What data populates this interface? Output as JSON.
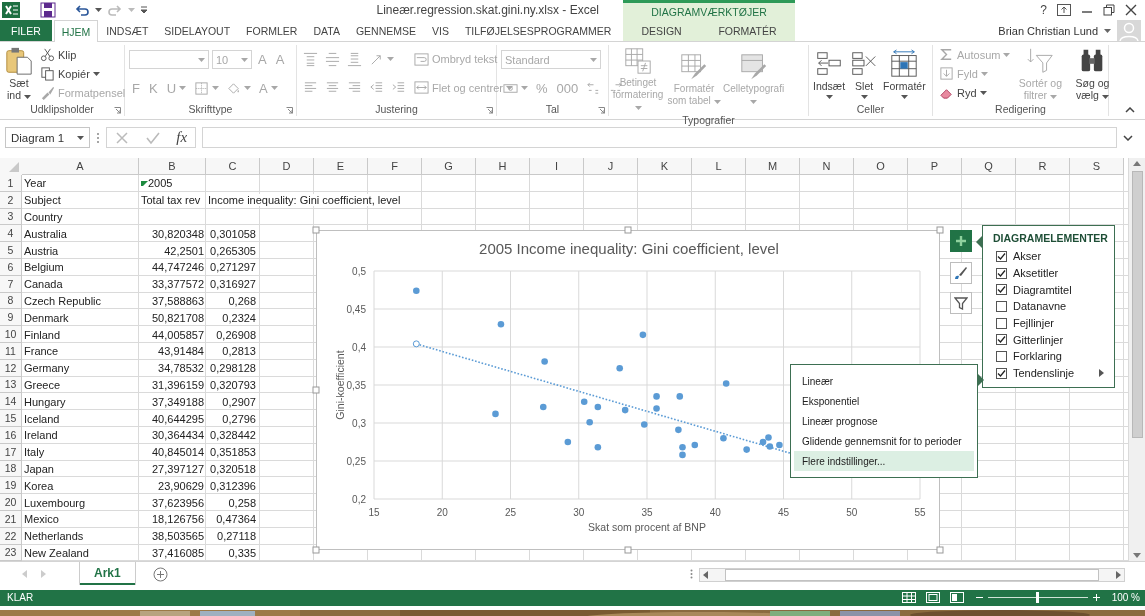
{
  "title_bar": {
    "title": "Lineær.regression.skat.gini.ny.xlsx - Excel",
    "context_label": "DIAGRAMVÆRKTØJER",
    "help": "?",
    "user": "Brian Christian Lund"
  },
  "tabs": [
    {
      "label": "FILER",
      "kind": "file",
      "selected": false
    },
    {
      "label": "HJEM",
      "kind": "tab",
      "selected": true
    },
    {
      "label": "INDSÆT",
      "kind": "tab",
      "selected": false
    },
    {
      "label": "SIDELAYOUT",
      "kind": "tab",
      "selected": false
    },
    {
      "label": "FORMLER",
      "kind": "tab",
      "selected": false
    },
    {
      "label": "DATA",
      "kind": "tab",
      "selected": false
    },
    {
      "label": "GENNEMSE",
      "kind": "tab",
      "selected": false
    },
    {
      "label": "VIS",
      "kind": "tab",
      "selected": false
    },
    {
      "label": "TILFØJELSESPROGRAMMER",
      "kind": "tab",
      "selected": false
    },
    {
      "label": "DESIGN",
      "kind": "context",
      "selected": false
    },
    {
      "label": "FORMATÉR",
      "kind": "context",
      "selected": false
    }
  ],
  "ribbon": {
    "groups": [
      {
        "label": "Udklipsholder",
        "launcher": true,
        "columns": [
          [
            [
              {
                "kind": "large",
                "label": "Sæt ind",
                "caret": true,
                "disabled": false
              }
            ]
          ],
          [
            [
              {
                "kind": "small",
                "label": "Klip",
                "caret": false,
                "disabled": false
              }
            ],
            [
              {
                "kind": "small",
                "label": "Kopiér",
                "caret": true,
                "disabled": false
              }
            ],
            [
              {
                "kind": "small",
                "label": "Formatpensel",
                "caret": false,
                "disabled": true
              }
            ]
          ]
        ]
      },
      {
        "label": "Skrifttype",
        "launcher": true,
        "columns": [
          [
            [
              {
                "kind": "name-field",
                "caret": true,
                "disabled": true
              },
              {
                "kind": "size-field",
                "value": "10",
                "caret": true,
                "disabled": true
              },
              {
                "kind": "glyph",
                "label": "A",
                "caret": false,
                "disabled": true
              },
              {
                "kind": "glyph",
                "label": "A",
                "caret": false,
                "disabled": true
              }
            ],
            [
              {
                "kind": "glyph",
                "label": "F",
                "caret": false,
                "disabled": true
              },
              {
                "kind": "glyph",
                "label": "K",
                "caret": false,
                "disabled": true
              },
              {
                "kind": "glyph",
                "label": "U",
                "caret": true,
                "disabled": true
              },
              {
                "kind": "icon",
                "caret": true,
                "disabled": true
              },
              {
                "kind": "icon",
                "caret": true,
                "disabled": true
              },
              {
                "kind": "glyph",
                "label": "A",
                "caret": true,
                "disabled": true
              }
            ]
          ]
        ]
      },
      {
        "label": "Justering",
        "launcher": true,
        "columns": [
          [
            [
              {
                "kind": "icon",
                "caret": false,
                "disabled": true
              },
              {
                "kind": "icon",
                "caret": false,
                "disabled": true
              },
              {
                "kind": "icon",
                "caret": false,
                "disabled": true
              },
              {
                "kind": "icon",
                "caret": true,
                "disabled": true
              }
            ],
            [
              {
                "kind": "icon",
                "caret": false,
                "disabled": true
              },
              {
                "kind": "icon",
                "caret": false,
                "disabled": true
              },
              {
                "kind": "icon",
                "caret": false,
                "disabled": true
              },
              {
                "kind": "icon",
                "caret": false,
                "disabled": true
              },
              {
                "kind": "icon",
                "caret": false,
                "disabled": true
              }
            ]
          ],
          [
            [
              {
                "kind": "small",
                "label": "Ombryd tekst",
                "caret": false,
                "disabled": true
              }
            ],
            [
              {
                "kind": "small",
                "label": "Flet og centrer",
                "caret": true,
                "disabled": true
              }
            ]
          ]
        ]
      },
      {
        "label": "Tal",
        "launcher": true,
        "columns": [
          [
            [
              {
                "kind": "name-field",
                "value": "Standard",
                "caret": true,
                "disabled": true
              }
            ],
            [
              {
                "kind": "icon",
                "caret": true,
                "disabled": true
              },
              {
                "kind": "glyph",
                "label": "%",
                "caret": false,
                "disabled": true
              },
              {
                "kind": "glyph",
                "label": "000",
                "caret": false,
                "disabled": true
              },
              {
                "kind": "icon",
                "caret": false,
                "disabled": true
              },
              {
                "kind": "icon",
                "caret": false,
                "disabled": true
              }
            ]
          ]
        ]
      },
      {
        "label": "Typografier",
        "launcher": false,
        "columns": [
          [
            [
              {
                "kind": "large",
                "label": "Betinget formatering",
                "caret": true,
                "disabled": true
              }
            ]
          ],
          [
            [
              {
                "kind": "large",
                "label": "Formatér som tabel",
                "caret": true,
                "disabled": true
              }
            ]
          ],
          [
            [
              {
                "kind": "large",
                "label": "Celletypografi",
                "caret": true,
                "disabled": true
              }
            ]
          ]
        ]
      },
      {
        "label": "Celler",
        "launcher": false,
        "columns": [
          [
            [
              {
                "kind": "large",
                "label": "Indsæt",
                "caret": true,
                "disabled": false
              }
            ]
          ],
          [
            [
              {
                "kind": "large",
                "label": "Slet",
                "caret": true,
                "disabled": false
              }
            ]
          ],
          [
            [
              {
                "kind": "large",
                "label": "Formatér",
                "caret": true,
                "disabled": false
              }
            ]
          ]
        ]
      },
      {
        "label": "Redigering",
        "launcher": false,
        "columns": [
          [
            [
              {
                "kind": "small",
                "label": "Autosum",
                "caret": true,
                "disabled": true
              }
            ],
            [
              {
                "kind": "small",
                "label": "Fyld",
                "caret": true,
                "disabled": true
              }
            ],
            [
              {
                "kind": "small",
                "label": "Ryd",
                "caret": true,
                "disabled": false
              }
            ]
          ],
          [
            [
              {
                "kind": "large",
                "label": "Sortér og filtrer",
                "caret": true,
                "disabled": true
              }
            ]
          ],
          [
            [
              {
                "kind": "large",
                "label": "Søg og vælg",
                "caret": true,
                "disabled": false
              }
            ]
          ]
        ]
      }
    ]
  },
  "formula_bar": {
    "name_box": "Diagram 1",
    "fx": "fx"
  },
  "sheet": {
    "columns": [
      "A",
      "B",
      "C",
      "D",
      "E",
      "F",
      "G",
      "H",
      "I",
      "J",
      "K",
      "L",
      "M",
      "N",
      "O",
      "P",
      "Q",
      "R",
      "S"
    ],
    "rows": [
      {
        "number": "1",
        "kind": "label",
        "error_mark": true,
        "cells": [
          "Year",
          "2005"
        ]
      },
      {
        "number": "2",
        "kind": "label",
        "error_mark": false,
        "cells": [
          "Subject",
          "Total tax rev",
          "Income inequality: Gini coefficient, level"
        ]
      },
      {
        "number": "3",
        "kind": "label",
        "error_mark": false,
        "cells": [
          "Country"
        ]
      },
      {
        "number": "4",
        "kind": "data",
        "error_mark": false,
        "cells": [
          "Australia",
          "30,820348",
          "0,301058"
        ]
      },
      {
        "number": "5",
        "kind": "data",
        "error_mark": false,
        "cells": [
          "Austria",
          "42,2501",
          "0,265305"
        ]
      },
      {
        "number": "6",
        "kind": "data",
        "error_mark": false,
        "cells": [
          "Belgium",
          "44,747246",
          "0,271297"
        ]
      },
      {
        "number": "7",
        "kind": "data",
        "error_mark": false,
        "cells": [
          "Canada",
          "33,377572",
          "0,316927"
        ]
      },
      {
        "number": "8",
        "kind": "data",
        "error_mark": false,
        "cells": [
          "Czech Republic",
          "37,588863",
          "0,268"
        ]
      },
      {
        "number": "9",
        "kind": "data",
        "error_mark": false,
        "cells": [
          "Denmark",
          "50,821708",
          "0,2324"
        ]
      },
      {
        "number": "10",
        "kind": "data",
        "error_mark": false,
        "cells": [
          "Finland",
          "44,005857",
          "0,26908"
        ]
      },
      {
        "number": "11",
        "kind": "data",
        "error_mark": false,
        "cells": [
          "France",
          "43,91484",
          "0,2813"
        ]
      },
      {
        "number": "12",
        "kind": "data",
        "error_mark": false,
        "cells": [
          "Germany",
          "34,78532",
          "0,298128"
        ]
      },
      {
        "number": "13",
        "kind": "data",
        "error_mark": false,
        "cells": [
          "Greece",
          "31,396159",
          "0,320793"
        ]
      },
      {
        "number": "14",
        "kind": "data",
        "error_mark": false,
        "cells": [
          "Hungary",
          "37,349188",
          "0,2907"
        ]
      },
      {
        "number": "15",
        "kind": "data",
        "error_mark": false,
        "cells": [
          "Iceland",
          "40,644295",
          "0,2796"
        ]
      },
      {
        "number": "16",
        "kind": "data",
        "error_mark": false,
        "cells": [
          "Ireland",
          "30,364434",
          "0,328442"
        ]
      },
      {
        "number": "17",
        "kind": "data",
        "error_mark": false,
        "cells": [
          "Italy",
          "40,845014",
          "0,351853"
        ]
      },
      {
        "number": "18",
        "kind": "data",
        "error_mark": false,
        "cells": [
          "Japan",
          "27,397127",
          "0,320518"
        ]
      },
      {
        "number": "19",
        "kind": "data",
        "error_mark": false,
        "cells": [
          "Korea",
          "23,90629",
          "0,312396"
        ]
      },
      {
        "number": "20",
        "kind": "data",
        "error_mark": false,
        "cells": [
          "Luxembourg",
          "37,623956",
          "0,258"
        ]
      },
      {
        "number": "21",
        "kind": "data",
        "error_mark": false,
        "cells": [
          "Mexico",
          "18,126756",
          "0,47364"
        ]
      },
      {
        "number": "22",
        "kind": "data",
        "error_mark": false,
        "cells": [
          "Netherlands",
          "38,503565",
          "0,27118"
        ]
      },
      {
        "number": "23",
        "kind": "data",
        "error_mark": false,
        "cells": [
          "New Zealand",
          "37,416085",
          "0,335"
        ]
      }
    ]
  },
  "chart": {
    "chart_data": {
      "type": "scatter",
      "title": "2005 Income inequality: Gini coefficient, level",
      "xlabel": "Skat som procent af BNP",
      "ylabel": "Gini-koefficient",
      "x": [
        18.1,
        24.3,
        23.9,
        27.4,
        27.5,
        29.2,
        30.4,
        30.8,
        31.4,
        31.4,
        33.0,
        33.4,
        34.7,
        34.8,
        35.7,
        35.7,
        37.4,
        37.3,
        37.6,
        37.6,
        38.5,
        40.6,
        40.8,
        42.3,
        43.5,
        43.9,
        44.0,
        44.7
      ],
      "series": [
        {
          "color": "#5b9bd5",
          "values": [
            0.474,
            0.43,
            0.312,
            0.321,
            0.381,
            0.275,
            0.328,
            0.301,
            0.321,
            0.268,
            0.372,
            0.317,
            0.416,
            0.298,
            0.335,
            0.319,
            0.335,
            0.291,
            0.268,
            0.258,
            0.271,
            0.28,
            0.352,
            0.265,
            0.275,
            0.281,
            0.269,
            0.271
          ]
        }
      ],
      "grid": true,
      "xlim": [
        15,
        55
      ],
      "ylim": [
        0.2,
        0.5
      ],
      "xticks": [
        15,
        20,
        25,
        30,
        35,
        40,
        45,
        50,
        55
      ],
      "yticks": [
        {
          "value": 0.2,
          "label": "0,2"
        },
        {
          "value": 0.25,
          "label": "0,25"
        },
        {
          "value": 0.3,
          "label": "0,3"
        },
        {
          "value": 0.35,
          "label": "0,35"
        },
        {
          "value": 0.4,
          "label": "0,4"
        },
        {
          "value": 0.45,
          "label": "0,45"
        },
        {
          "value": 0.5,
          "label": "0,5"
        }
      ]
    }
  },
  "chart_elements": {
    "title": "DIAGRAMELEMENTER",
    "items": [
      {
        "label": "Akser",
        "kind": "check",
        "checked": true
      },
      {
        "label": "Aksetitler",
        "kind": "check",
        "checked": true
      },
      {
        "label": "Diagramtitel",
        "kind": "check",
        "checked": true
      },
      {
        "label": "Datanavne",
        "kind": "check",
        "checked": false
      },
      {
        "label": "Fejllinjer",
        "kind": "check",
        "checked": false
      },
      {
        "label": "Gitterlinjer",
        "kind": "check",
        "checked": true
      },
      {
        "label": "Forklaring",
        "kind": "check",
        "checked": false
      },
      {
        "label": "Tendenslinje",
        "kind": "submenu",
        "checked": true
      }
    ]
  },
  "trendline_menu": {
    "items": [
      {
        "label": "Lineær",
        "selected": false
      },
      {
        "label": "Eksponentiel",
        "selected": false
      },
      {
        "label": "Lineær prognose",
        "selected": false
      },
      {
        "label": "Glidende gennemsnit for to perioder",
        "selected": false
      },
      {
        "label": "Flere indstillinger...",
        "selected": true
      }
    ]
  },
  "sheet_tabs": [
    {
      "label": "Ark1",
      "selected": true
    }
  ],
  "status_bar": {
    "status": "KLAR",
    "zoom": "100 %",
    "zoom_slider": {
      "level": 0.5
    }
  }
}
